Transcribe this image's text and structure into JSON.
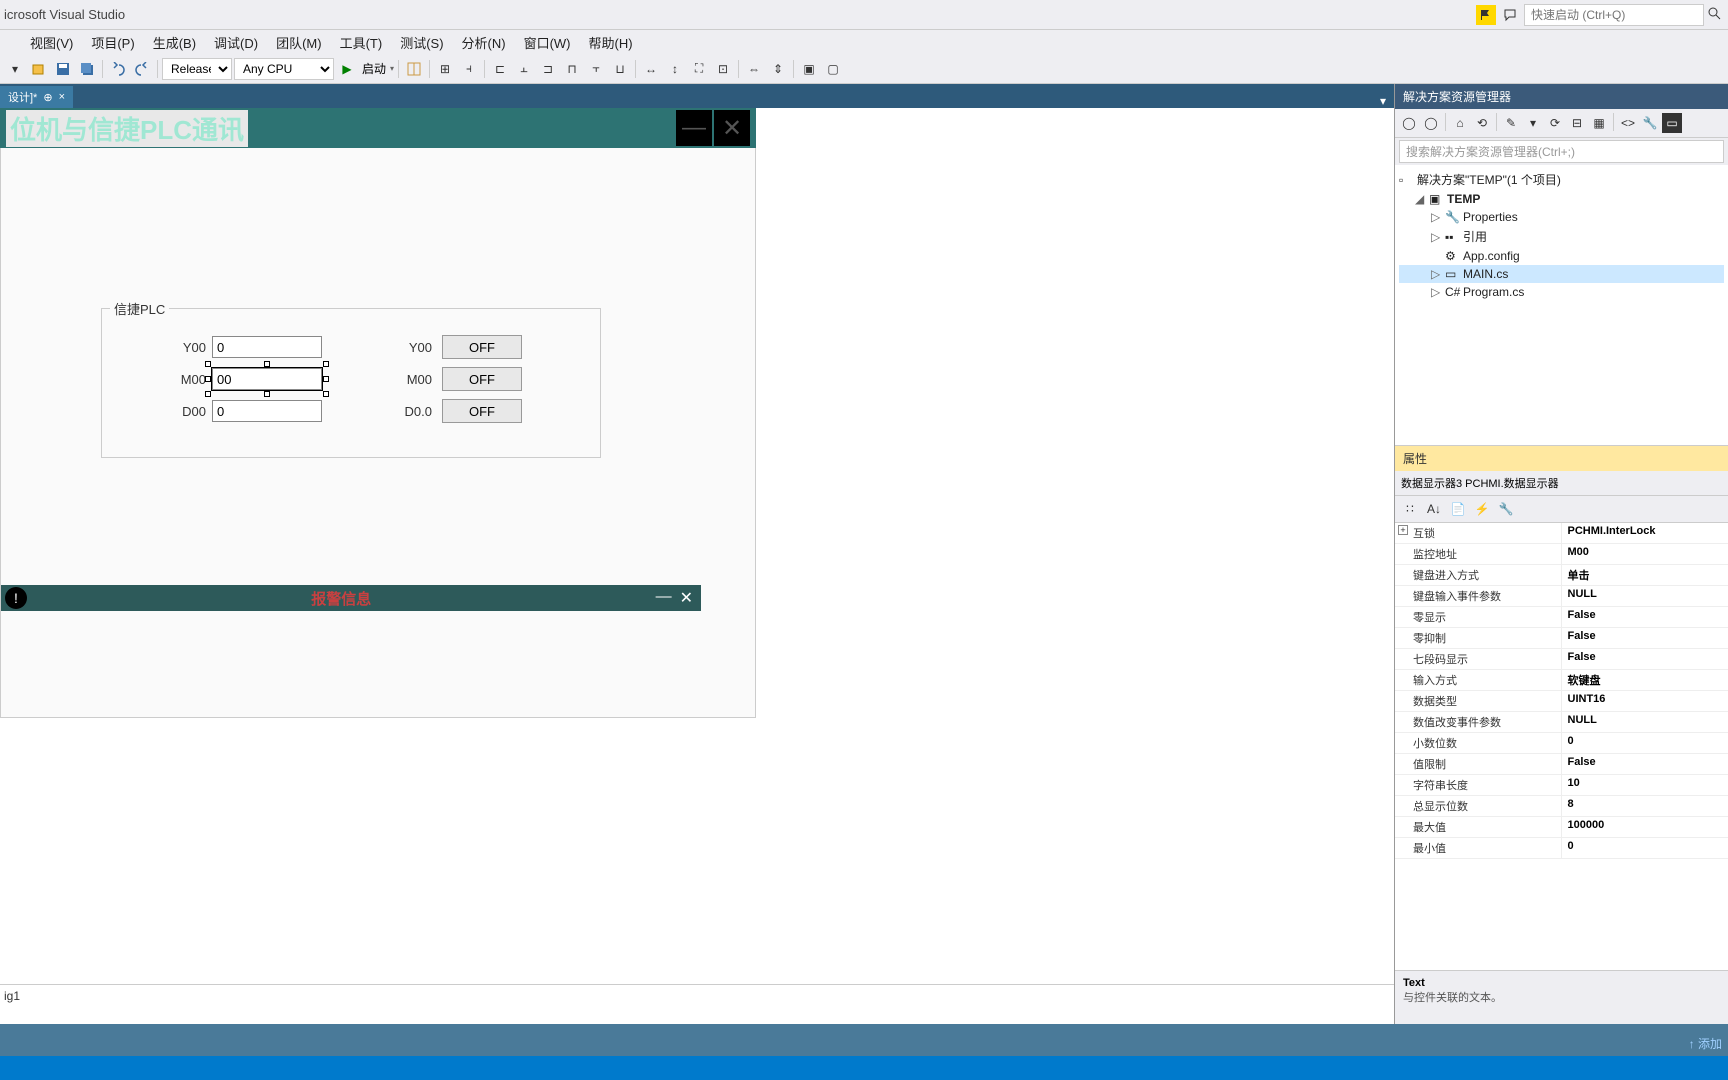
{
  "titlebar": {
    "app": "icrosoft Visual Studio",
    "search_placeholder": "快速启动 (Ctrl+Q)"
  },
  "menus": [
    "",
    "视图(V)",
    "项目(P)",
    "生成(B)",
    "调试(D)",
    "团队(M)",
    "工具(T)",
    "测试(S)",
    "分析(N)",
    "窗口(W)",
    "帮助(H)"
  ],
  "toolbar": {
    "config": "Release",
    "platform": "Any CPU",
    "start": "启动"
  },
  "document_tab": {
    "title": "设计]*",
    "pinned": "⊕"
  },
  "form": {
    "title": "位机与信捷PLC通讯",
    "groupbox": "信捷PLC",
    "rows_left": [
      {
        "label": "Y00",
        "value": "0"
      },
      {
        "label": "M00",
        "value": "00"
      },
      {
        "label": "D00",
        "value": "0"
      }
    ],
    "rows_right": [
      {
        "label": "Y00",
        "btn": "OFF"
      },
      {
        "label": "M00",
        "btn": "OFF"
      },
      {
        "label": "D0.0",
        "btn": "OFF"
      }
    ],
    "alarm": "报警信息",
    "config_item": "ig1"
  },
  "solution_explorer": {
    "title": "解决方案资源管理器",
    "search": "搜索解决方案资源管理器(Ctrl+;)",
    "root": "解决方案\"TEMP\"(1 个项目)",
    "project": "TEMP",
    "items": [
      "Properties",
      "引用",
      "App.config",
      "MAIN.cs",
      "Program.cs"
    ]
  },
  "properties": {
    "title": "属性",
    "object": "数据显示器3  PCHMI.数据显示器",
    "rows": [
      {
        "name": "互锁",
        "value": "PCHMI.InterLock",
        "bold": true,
        "expand": true
      },
      {
        "name": "监控地址",
        "value": "M00",
        "bold": true
      },
      {
        "name": "键盘进入方式",
        "value": "单击",
        "bold": true
      },
      {
        "name": "键盘输入事件参数",
        "value": "NULL",
        "bold": true
      },
      {
        "name": "零显示",
        "value": "False",
        "bold": true
      },
      {
        "name": "零抑制",
        "value": "False",
        "bold": true
      },
      {
        "name": "七段码显示",
        "value": "False",
        "bold": true
      },
      {
        "name": "输入方式",
        "value": "软键盘",
        "bold": true
      },
      {
        "name": "数据类型",
        "value": "UINT16",
        "bold": true
      },
      {
        "name": "数值改变事件参数",
        "value": "NULL",
        "bold": true
      },
      {
        "name": "小数位数",
        "value": "0",
        "bold": true
      },
      {
        "name": "值限制",
        "value": "False",
        "bold": true
      },
      {
        "name": "字符串长度",
        "value": "10",
        "bold": true
      },
      {
        "name": "总显示位数",
        "value": "8",
        "bold": true
      },
      {
        "name": "最大值",
        "value": "100000",
        "bold": true
      },
      {
        "name": "最小值",
        "value": "0",
        "bold": true
      }
    ],
    "desc_title": "Text",
    "desc_text": "与控件关联的文本。"
  },
  "footer": {
    "add": "↑ 添加"
  }
}
